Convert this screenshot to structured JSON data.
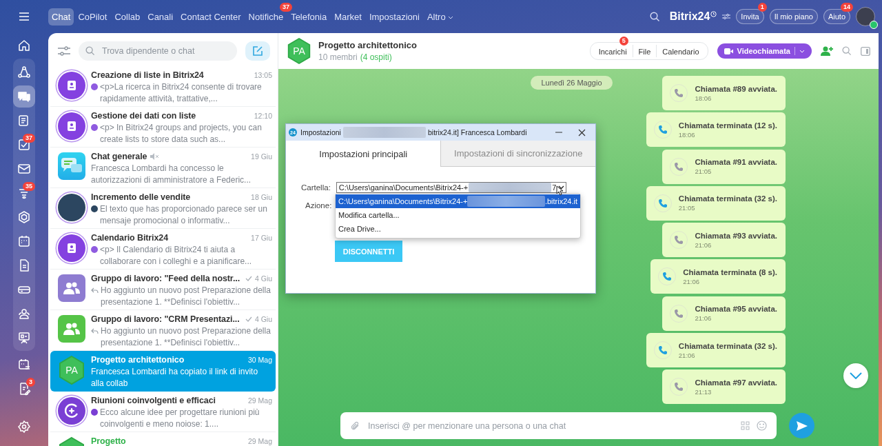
{
  "top_nav": {
    "tabs": [
      {
        "label": "Chat",
        "selected": true
      },
      {
        "label": "CoPilot",
        "selected": false
      },
      {
        "label": "Collab",
        "selected": false
      },
      {
        "label": "Canali",
        "selected": false
      },
      {
        "label": "Contact Center",
        "selected": false
      },
      {
        "label": "Notifiche",
        "selected": false,
        "badge": "37"
      },
      {
        "label": "Telefonia",
        "selected": false
      },
      {
        "label": "Market",
        "selected": false
      },
      {
        "label": "Impostazioni",
        "selected": false
      },
      {
        "label": "Altro",
        "selected": false,
        "caret": true
      }
    ],
    "brand": "Bitrix24",
    "buttons": [
      {
        "label": "Invita",
        "badge": "1"
      },
      {
        "label": "Il mio piano"
      },
      {
        "label": "Aiuto",
        "badge": "14"
      }
    ]
  },
  "rail": {
    "items_before": [
      {
        "kind": "home",
        "selected": false
      }
    ],
    "pinned_items": [
      {
        "kind": "nodes",
        "selected": false
      },
      {
        "kind": "chat",
        "selected": true
      },
      {
        "kind": "news",
        "selected": false
      },
      {
        "kind": "tasks",
        "selected": false,
        "badge": "37"
      },
      {
        "kind": "mail",
        "selected": false
      },
      {
        "kind": "funnel",
        "selected": false,
        "badge": "35"
      },
      {
        "kind": "hexagon",
        "selected": false
      },
      {
        "kind": "calendar",
        "selected": false
      },
      {
        "kind": "document",
        "selected": false
      },
      {
        "kind": "drive",
        "selected": false
      },
      {
        "kind": "contacts",
        "selected": false
      },
      {
        "kind": "board",
        "selected": false
      }
    ],
    "items_after": [
      {
        "kind": "schedule",
        "selected": false
      },
      {
        "kind": "edit",
        "selected": false,
        "badge": "3"
      }
    ]
  },
  "chat_list": {
    "search": {
      "placeholder": "Trova dipendente o chat"
    },
    "chats": [
      {
        "title": "Creazione di liste in Bitrix24",
        "time": "13:05",
        "preview": "<p>La ricerca in Bitrix24 consente di trovare rapidamente attività, trattative,...",
        "avatar": {
          "kind": "list"
        },
        "preview_icon": {
          "kind": "bot"
        },
        "selected": false
      },
      {
        "title": "Gestione dei dati con liste",
        "time": "12:10",
        "preview": "<p> In Bitrix24 groups and projects, you can create lists to store data such as...",
        "avatar": {
          "kind": "list"
        },
        "preview_icon": {
          "kind": "bot"
        },
        "selected": false
      },
      {
        "title": "Chat generale",
        "time": "19 Giu",
        "preview": "Francesca Lombardi ha concesso le autorizzazioni di amministratore a Federic...",
        "avatar": {
          "kind": "general"
        },
        "muted": true,
        "selected": false
      },
      {
        "title": "Incremento delle vendite",
        "time": "18 Giu",
        "preview": "El texto que has proporcionado parece ser un mensaje promocional o informativ...",
        "avatar": {
          "kind": "photo"
        },
        "preview_icon": {
          "kind": "photo"
        },
        "selected": false
      },
      {
        "title": "Calendario Bitrix24",
        "time": "17 Giu",
        "preview": "<p> Il Calendario di Bitrix24 ti aiuta a collaborare con i colleghi e a pianificare...",
        "avatar": {
          "kind": "list"
        },
        "preview_icon": {
          "kind": "bot"
        },
        "selected": false
      },
      {
        "title": "Gruppo di lavoro: \"Feed della nostr...",
        "time": "4 Giu",
        "preview": "Ho aggiunto un nuovo post Preparazione della presentazione 1. **Definisci l'obiettiv...",
        "avatar": {
          "kind": "group",
          "color": "#8e7cd1"
        },
        "preview_icon": {
          "kind": "reply"
        },
        "read": true,
        "selected": false
      },
      {
        "title": "Gruppo di lavoro: \"CRM Presentazi...",
        "time": "4 Giu",
        "preview": "Ho aggiunto un nuovo post Preparazione della presentazione 1. **Definisci l'obiettiv...",
        "avatar": {
          "kind": "group",
          "color": "#55c447"
        },
        "preview_icon": {
          "kind": "reply"
        },
        "read": true,
        "selected": false
      },
      {
        "title": "Progetto architettonico",
        "time": "30 Mag",
        "preview": "Francesca Lombardi ha copiato il link di invito alla collab",
        "avatar": {
          "kind": "collab",
          "initials": "PA"
        },
        "selected": true
      },
      {
        "title": "Riunioni coinvolgenti e efficaci",
        "time": "29 Mag",
        "preview": "Ecco alcune idee per progettare riunioni più coinvolgenti e meno noiose: 1....",
        "avatar": {
          "kind": "copilot"
        },
        "preview_icon": {
          "kind": "copilot"
        },
        "selected": false
      },
      {
        "title": "Progetto",
        "time": "29 Mag",
        "avatar": {
          "kind": "collab"
        },
        "selected": false
      }
    ]
  },
  "chat": {
    "avatar": "PA",
    "title": "Progetto architettonico",
    "members": "10 membri",
    "guests": "(4 ospiti)",
    "tabs": [
      {
        "label": "Incarichi",
        "badge": "5"
      },
      {
        "label": "File"
      },
      {
        "label": "Calendario"
      }
    ],
    "video_button": "Videochiamata",
    "date": "Lunedì 26 Maggio",
    "messages": [
      {
        "kind": "started",
        "text": "Chiamata #89 avviata.",
        "time": "18:06"
      },
      {
        "kind": "ended",
        "text": "Chiamata terminata (12 s).",
        "time": "18:06"
      },
      {
        "kind": "started",
        "text": "Chiamata #91 avviata.",
        "time": "21:05"
      },
      {
        "kind": "ended",
        "text": "Chiamata terminata (32 s).",
        "time": "21:05"
      },
      {
        "kind": "started",
        "text": "Chiamata #93 avviata.",
        "time": "21:06"
      },
      {
        "kind": "ended",
        "text": "Chiamata terminata (8 s).",
        "time": "21:06"
      },
      {
        "kind": "started",
        "text": "Chiamata #95 avviata.",
        "time": "21:06"
      },
      {
        "kind": "ended",
        "text": "Chiamata terminata (32 s).",
        "time": "21:06"
      },
      {
        "kind": "started",
        "text": "Chiamata #97 avviata.",
        "time": "21:13"
      }
    ],
    "composer": {
      "placeholder": "Inserisci @ per menzionare una persona o una chat"
    }
  },
  "dialog": {
    "logo": "24",
    "title_start": "Impostazioni",
    "title_end": "bitrix24.it] Francesca Lombardi",
    "tabs": [
      {
        "label": "Impostazioni principali",
        "selected": true
      },
      {
        "label": "Impostazioni di sincronizzazione",
        "selected": false
      }
    ],
    "folder_label": "Cartella:",
    "folder_value_start": "C:\\Users\\ganina\\Documents\\Bitrix24-+",
    "folder_value_end": "7",
    "options": [
      {
        "start": "C:\\Users\\ganina\\Documents\\Bitrix24-+",
        "end": ".bitrix24.it",
        "selected": true
      },
      {
        "start": "Modifica cartella...",
        "selected": false
      },
      {
        "start": "Crea Drive...",
        "selected": false
      }
    ],
    "action_label": "Azione:",
    "button": "DISCONNETTI"
  }
}
